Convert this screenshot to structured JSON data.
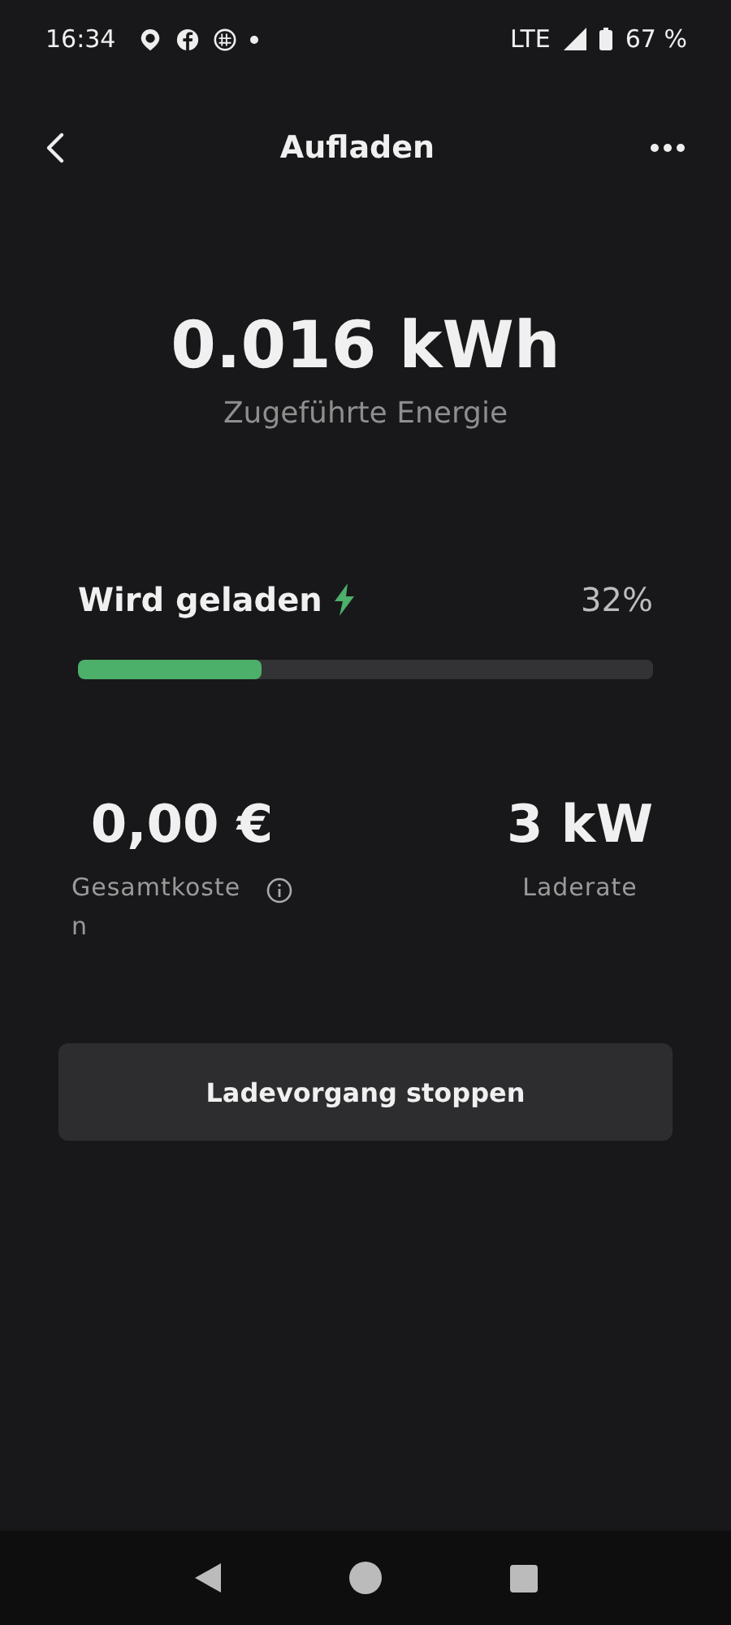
{
  "status_bar": {
    "time": "16:34",
    "network": "LTE",
    "battery": "67 %"
  },
  "header": {
    "title": "Aufladen"
  },
  "energy": {
    "value": "0.016 kWh",
    "label": "Zugeführte Energie"
  },
  "charging": {
    "status": "Wird geladen",
    "percent": "32%",
    "level": 0.32
  },
  "stats": [
    {
      "value": "0,00 €",
      "label": "Gesamtkosten",
      "info": true
    },
    {
      "value": "3 kW",
      "label": "Laderate",
      "info": false
    }
  ],
  "stop_button": {
    "label": "Ladevorgang stoppen"
  }
}
